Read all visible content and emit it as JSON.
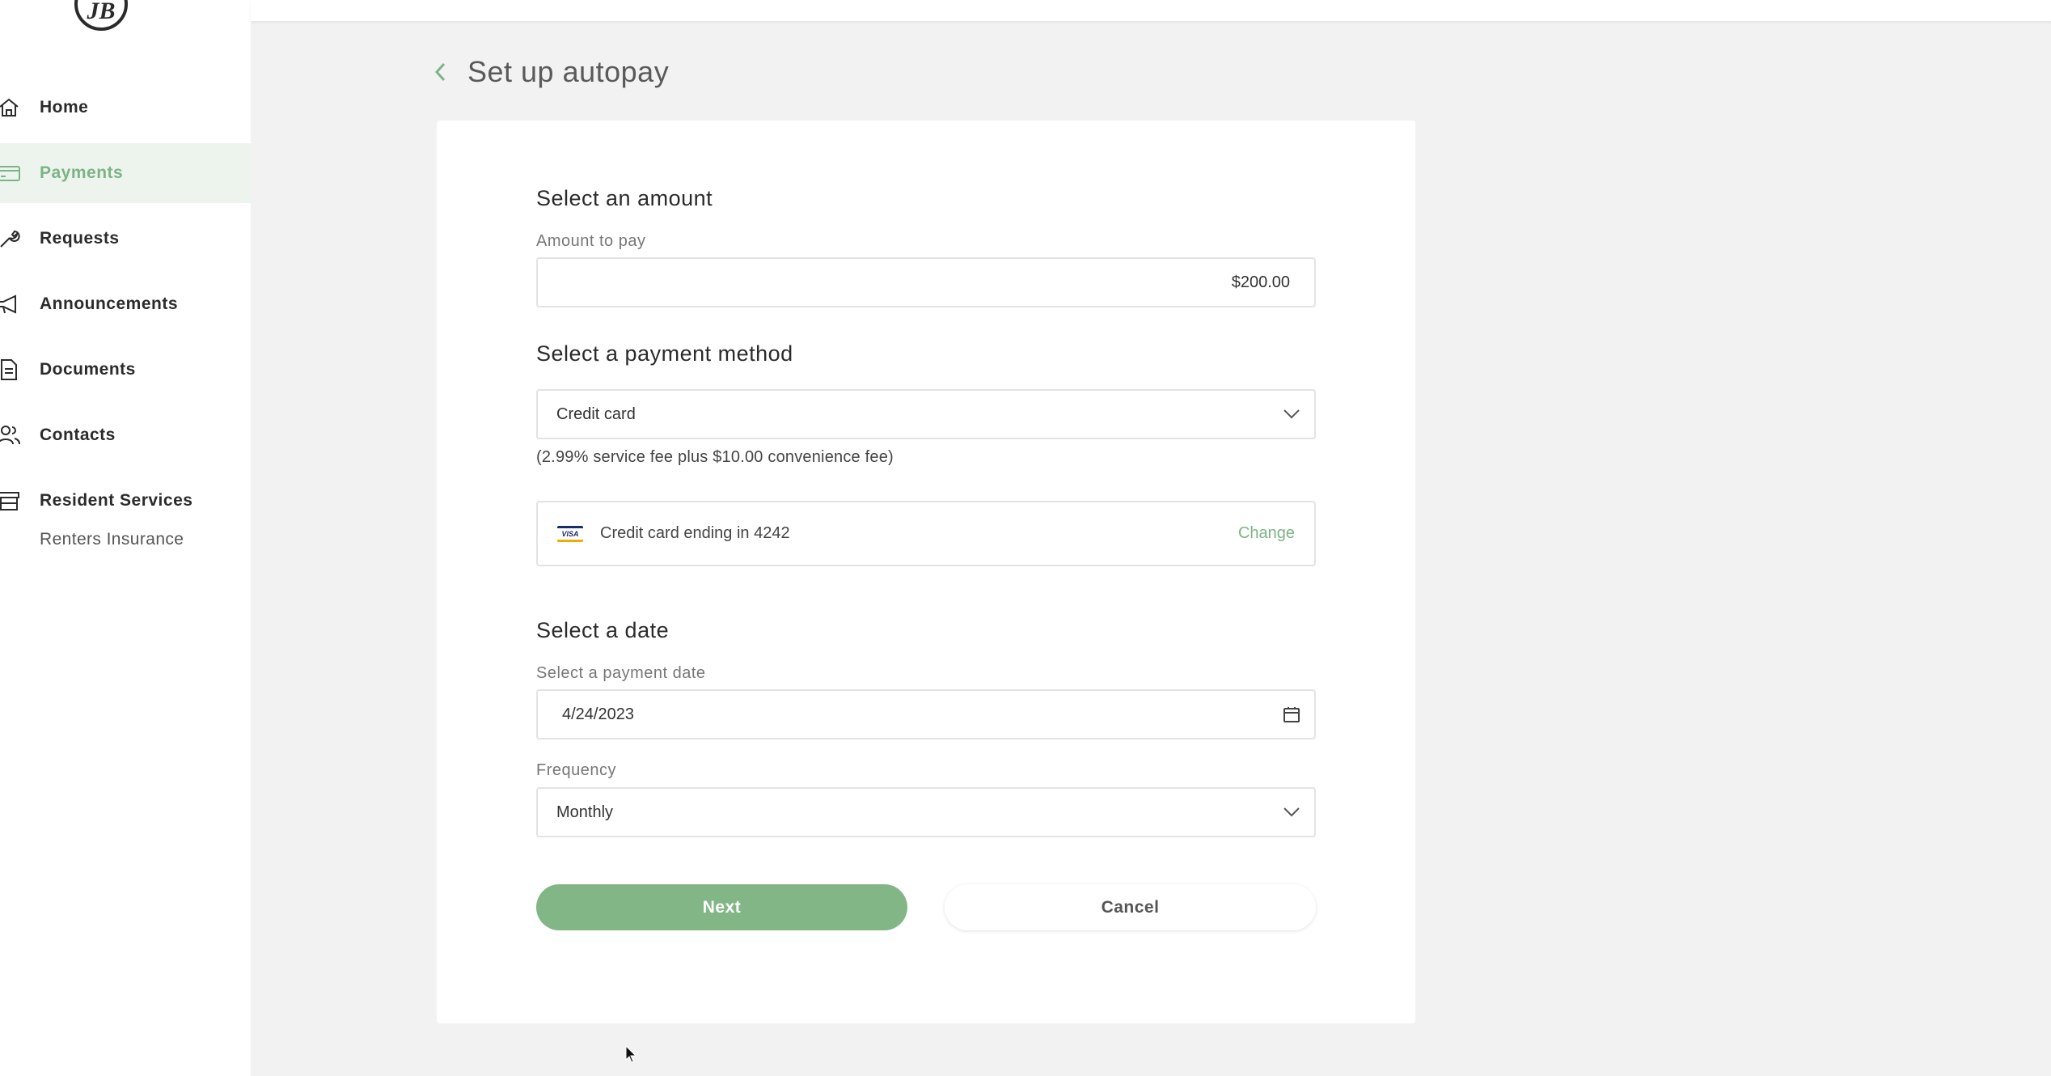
{
  "sidebar": {
    "logo_text": "JB",
    "items": [
      {
        "label": "Home",
        "icon": "home-icon"
      },
      {
        "label": "Payments",
        "icon": "credit-card-icon",
        "active": true
      },
      {
        "label": "Requests",
        "icon": "wrench-icon"
      },
      {
        "label": "Announcements",
        "icon": "megaphone-icon"
      },
      {
        "label": "Documents",
        "icon": "document-icon"
      },
      {
        "label": "Contacts",
        "icon": "people-icon"
      },
      {
        "label": "Resident Services",
        "icon": "storefront-icon"
      }
    ],
    "sub_items": [
      {
        "label": "Renters Insurance"
      }
    ]
  },
  "header": {
    "title": "Set up autopay",
    "back_icon": "chevron-left-icon"
  },
  "form": {
    "amount": {
      "section_title": "Select an amount",
      "label": "Amount to pay",
      "value": "$200.00"
    },
    "payment_method": {
      "section_title": "Select a payment method",
      "selected": "Credit card",
      "fee_note": "(2.99% service fee plus $10.00 convenience fee)",
      "card_text": "Credit card ending in 4242",
      "card_brand": "VISA",
      "change_label": "Change"
    },
    "date": {
      "section_title": "Select a date",
      "label": "Select a payment date",
      "value": "4/24/2023",
      "frequency_label": "Frequency",
      "frequency_value": "Monthly"
    },
    "buttons": {
      "next": "Next",
      "cancel": "Cancel"
    }
  },
  "colors": {
    "accent": "#82b687",
    "accent_text": "#7db386",
    "active_bg": "#edf4ee",
    "page_bg": "#f2f2f2"
  }
}
